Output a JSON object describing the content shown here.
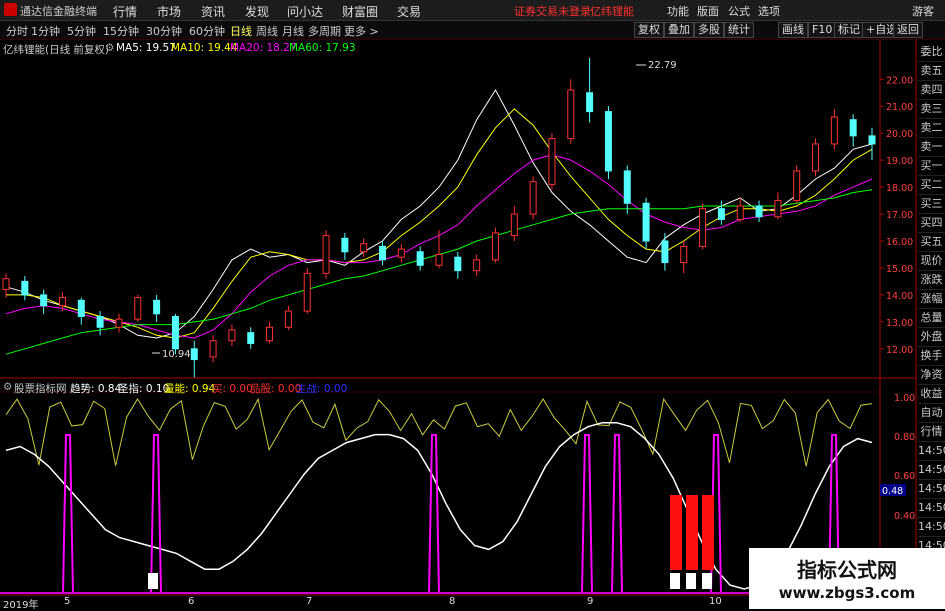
{
  "app": {
    "title": "通达信金融终端",
    "menu": [
      "行情",
      "市场",
      "资讯",
      "发现",
      "问小达",
      "财富圈",
      "交易"
    ],
    "warning": "证券交易未登录",
    "stock_link": "亿纬锂能",
    "right_menu": [
      "功能",
      "版面",
      "公式",
      "选项"
    ],
    "user": "游客"
  },
  "toolbar": {
    "periods": [
      "分时",
      "1分钟",
      "5分钟",
      "15分钟",
      "30分钟",
      "60分钟",
      "日线",
      "周线",
      "月线",
      "多周期",
      "更多 >"
    ],
    "active_period": "日线",
    "buttons": [
      "复权",
      "叠加",
      "多股",
      "统计",
      "画线",
      "F10",
      "标记",
      "+自选",
      "返回"
    ]
  },
  "price_panel": {
    "title": "亿纬锂能(日线 前复权)",
    "ma": [
      {
        "label": "MA5: 19.57",
        "color": "#ffffff"
      },
      {
        "label": "MA10: 19.44",
        "color": "#ffff00"
      },
      {
        "label": "MA20: 18.27",
        "color": "#ff00ff"
      },
      {
        "label": "MA60: 17.93",
        "color": "#00ff00"
      }
    ],
    "high_label": "22.79",
    "low_label": "10.94",
    "y_ticks": [
      "22.00",
      "21.00",
      "20.00",
      "19.00",
      "18.00",
      "17.00",
      "16.00",
      "15.00",
      "14.00",
      "13.00",
      "12.00"
    ]
  },
  "side_panel": [
    "委比",
    "卖五",
    "卖四",
    "卖三",
    "卖二",
    "卖一",
    "买一",
    "买二",
    "买三",
    "买四",
    "买五",
    "现价",
    "涨跌",
    "涨幅",
    "总量",
    "外盘",
    "换手",
    "净资",
    "收益",
    "自动",
    "行情",
    "14:50",
    "14:50",
    "14:50",
    "14:50",
    "14:50",
    "14:50",
    "14:50",
    "14:50"
  ],
  "indicator_panel": {
    "title": "股票指标网",
    "items": [
      {
        "label": "趋势: 0.84",
        "color": "#ffffff"
      },
      {
        "label": "圣指: 0.10",
        "color": "#ffffff"
      },
      {
        "label": "量能: 0.94",
        "color": "#ffff00"
      },
      {
        "label": "买: 0.00",
        "color": "#ff3030"
      },
      {
        "label": "品股: 0.00",
        "color": "#ff3030"
      },
      {
        "label": "主战: 0.00",
        "color": "#3030ff"
      }
    ],
    "y_ticks": [
      "1.00",
      "0.80",
      "0.60",
      "0.40"
    ],
    "current_value": "0.48"
  },
  "x_axis": {
    "labels": [
      "2019年",
      "5",
      "6",
      "7",
      "8",
      "9",
      "10"
    ]
  },
  "watermark": {
    "line1": "指标公式网",
    "line2": "www.zbgs3.com"
  },
  "chart_data": {
    "type": "line",
    "title": "亿纬锂能(日线 前复权)",
    "ylim": [
      11.4,
      22.9
    ],
    "series": [
      {
        "name": "MA5",
        "values": [
          14.3,
          14.1,
          13.8,
          13.6,
          13.4,
          13.2,
          12.9,
          12.5,
          12.4,
          12.6,
          13.2,
          14.2,
          15.3,
          15.7,
          15.4,
          15.5,
          15.2,
          15.3,
          15.1,
          15.6,
          16.0,
          16.8,
          17.3,
          18.0,
          19.0,
          20.5,
          21.6,
          20.3,
          18.9,
          17.8,
          17.1,
          16.6,
          16.0,
          15.4,
          15.2,
          16.1,
          16.6,
          17.0,
          17.3,
          17.6,
          17.1,
          17.2,
          17.7,
          18.3,
          18.7,
          19.4,
          19.6
        ]
      },
      {
        "name": "MA10",
        "values": [
          14.0,
          14.0,
          13.9,
          13.6,
          13.4,
          13.2,
          13.0,
          12.8,
          12.5,
          12.4,
          12.6,
          13.5,
          14.5,
          15.4,
          15.6,
          15.5,
          15.3,
          15.3,
          15.2,
          15.3,
          15.6,
          16.2,
          16.7,
          17.3,
          18.0,
          19.2,
          20.2,
          20.9,
          20.3,
          19.3,
          18.4,
          17.6,
          16.8,
          16.2,
          15.7,
          15.6,
          16.0,
          16.5,
          16.9,
          17.2,
          17.2,
          17.1,
          17.3,
          17.7,
          18.3,
          19.0,
          19.4
        ]
      },
      {
        "name": "MA20",
        "values": [
          13.3,
          13.5,
          13.6,
          13.5,
          13.3,
          13.1,
          13.0,
          12.9,
          12.7,
          12.5,
          12.4,
          12.7,
          13.3,
          14.1,
          14.7,
          15.1,
          15.3,
          15.3,
          15.2,
          15.2,
          15.3,
          15.5,
          15.9,
          16.2,
          16.6,
          17.3,
          17.9,
          18.5,
          19.0,
          19.2,
          19.0,
          18.6,
          18.1,
          17.5,
          17.0,
          16.7,
          16.5,
          16.4,
          16.5,
          16.8,
          16.9,
          17.0,
          17.1,
          17.3,
          17.7,
          18.0,
          18.3
        ]
      },
      {
        "name": "MA60",
        "values": [
          11.8,
          12.0,
          12.2,
          12.4,
          12.6,
          12.7,
          12.8,
          12.9,
          12.9,
          12.9,
          13.0,
          13.1,
          13.3,
          13.5,
          13.8,
          14.0,
          14.2,
          14.4,
          14.6,
          14.7,
          14.9,
          15.1,
          15.3,
          15.5,
          15.7,
          16.0,
          16.2,
          16.4,
          16.6,
          16.8,
          17.0,
          17.1,
          17.2,
          17.2,
          17.2,
          17.2,
          17.2,
          17.3,
          17.3,
          17.3,
          17.3,
          17.3,
          17.4,
          17.5,
          17.6,
          17.8,
          17.9
        ]
      }
    ],
    "candles": [
      {
        "o": 14.2,
        "c": 14.6,
        "h": 14.8,
        "l": 13.9
      },
      {
        "o": 14.5,
        "c": 14.0,
        "h": 14.7,
        "l": 13.8
      },
      {
        "o": 14.0,
        "c": 13.6,
        "h": 14.2,
        "l": 13.3
      },
      {
        "o": 13.6,
        "c": 13.9,
        "h": 14.1,
        "l": 13.4
      },
      {
        "o": 13.8,
        "c": 13.2,
        "h": 13.9,
        "l": 12.9
      },
      {
        "o": 13.2,
        "c": 12.8,
        "h": 13.4,
        "l": 12.5
      },
      {
        "o": 12.8,
        "c": 13.1,
        "h": 13.3,
        "l": 12.6
      },
      {
        "o": 13.1,
        "c": 13.9,
        "h": 14.0,
        "l": 13.0
      },
      {
        "o": 13.8,
        "c": 13.3,
        "h": 14.0,
        "l": 13.0
      },
      {
        "o": 13.2,
        "c": 12.0,
        "h": 13.3,
        "l": 11.8
      },
      {
        "o": 12.0,
        "c": 11.6,
        "h": 12.3,
        "l": 10.94
      },
      {
        "o": 11.7,
        "c": 12.3,
        "h": 12.5,
        "l": 11.5
      },
      {
        "o": 12.3,
        "c": 12.7,
        "h": 12.9,
        "l": 12.1
      },
      {
        "o": 12.6,
        "c": 12.2,
        "h": 12.8,
        "l": 12.0
      },
      {
        "o": 12.3,
        "c": 12.8,
        "h": 13.0,
        "l": 12.2
      },
      {
        "o": 12.8,
        "c": 13.4,
        "h": 13.6,
        "l": 12.7
      },
      {
        "o": 13.4,
        "c": 14.8,
        "h": 15.0,
        "l": 13.3
      },
      {
        "o": 14.8,
        "c": 16.2,
        "h": 16.4,
        "l": 14.6
      },
      {
        "o": 16.1,
        "c": 15.6,
        "h": 16.3,
        "l": 15.3
      },
      {
        "o": 15.6,
        "c": 15.9,
        "h": 16.1,
        "l": 15.4
      },
      {
        "o": 15.8,
        "c": 15.3,
        "h": 16.0,
        "l": 15.1
      },
      {
        "o": 15.4,
        "c": 15.7,
        "h": 15.9,
        "l": 15.2
      },
      {
        "o": 15.6,
        "c": 15.1,
        "h": 15.8,
        "l": 14.9
      },
      {
        "o": 15.1,
        "c": 15.5,
        "h": 16.4,
        "l": 15.0
      },
      {
        "o": 15.4,
        "c": 14.9,
        "h": 15.6,
        "l": 14.6
      },
      {
        "o": 14.9,
        "c": 15.3,
        "h": 15.5,
        "l": 14.7
      },
      {
        "o": 15.3,
        "c": 16.3,
        "h": 16.5,
        "l": 15.2
      },
      {
        "o": 16.2,
        "c": 17.0,
        "h": 17.3,
        "l": 16.0
      },
      {
        "o": 17.0,
        "c": 18.2,
        "h": 18.4,
        "l": 16.8
      },
      {
        "o": 18.1,
        "c": 19.8,
        "h": 20.0,
        "l": 17.9
      },
      {
        "o": 19.8,
        "c": 21.6,
        "h": 22.0,
        "l": 19.6
      },
      {
        "o": 21.5,
        "c": 20.8,
        "h": 22.79,
        "l": 20.4
      },
      {
        "o": 20.8,
        "c": 18.6,
        "h": 21.0,
        "l": 18.3
      },
      {
        "o": 18.6,
        "c": 17.4,
        "h": 18.8,
        "l": 17.0
      },
      {
        "o": 17.4,
        "c": 16.0,
        "h": 17.6,
        "l": 15.7
      },
      {
        "o": 16.0,
        "c": 15.2,
        "h": 16.3,
        "l": 14.9
      },
      {
        "o": 15.2,
        "c": 15.8,
        "h": 16.0,
        "l": 14.8
      },
      {
        "o": 15.8,
        "c": 17.2,
        "h": 17.4,
        "l": 15.7
      },
      {
        "o": 17.2,
        "c": 16.8,
        "h": 17.5,
        "l": 16.6
      },
      {
        "o": 16.8,
        "c": 17.3,
        "h": 17.6,
        "l": 16.7
      },
      {
        "o": 17.3,
        "c": 16.9,
        "h": 17.5,
        "l": 16.7
      },
      {
        "o": 16.9,
        "c": 17.5,
        "h": 17.8,
        "l": 16.8
      },
      {
        "o": 17.5,
        "c": 18.6,
        "h": 18.8,
        "l": 17.4
      },
      {
        "o": 18.6,
        "c": 19.6,
        "h": 19.8,
        "l": 18.4
      },
      {
        "o": 19.6,
        "c": 20.6,
        "h": 20.9,
        "l": 19.4
      },
      {
        "o": 20.5,
        "c": 19.9,
        "h": 20.7,
        "l": 19.5
      },
      {
        "o": 19.9,
        "c": 19.6,
        "h": 20.2,
        "l": 19.0
      }
    ]
  }
}
